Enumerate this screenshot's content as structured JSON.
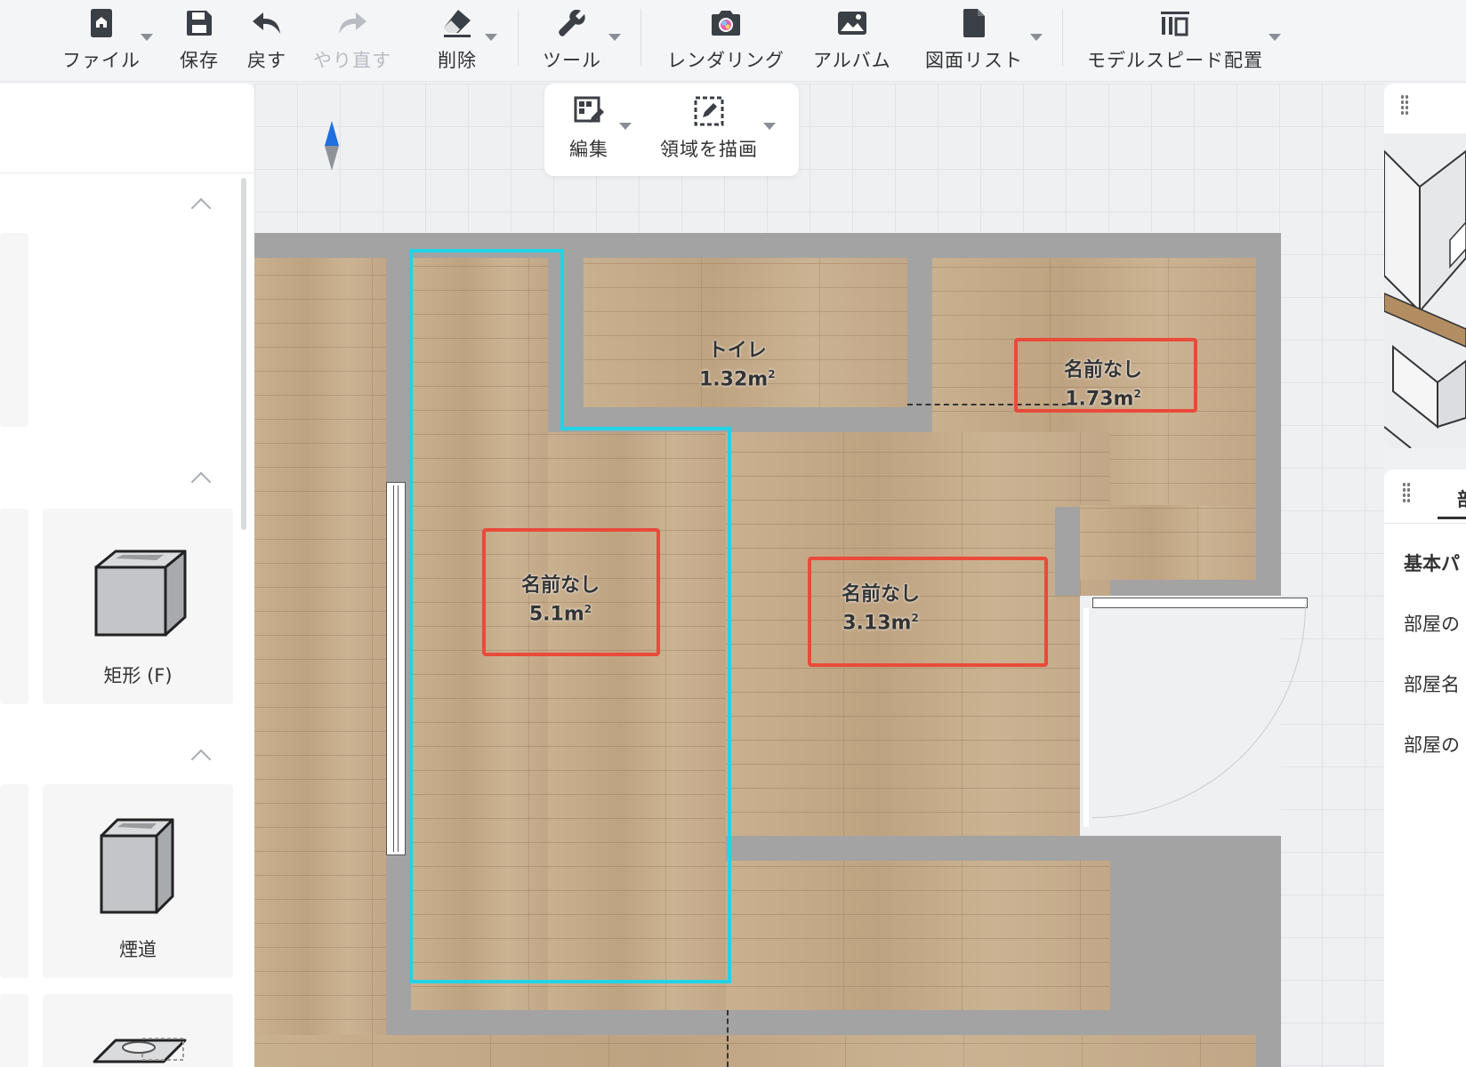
{
  "toolbar": {
    "file": "ファイル",
    "save": "保存",
    "undo": "戻す",
    "redo": "やり直す",
    "delete": "削除",
    "tools": "ツール",
    "rendering": "レンダリング",
    "album": "アルバム",
    "drawing_list": "図面リスト",
    "model_speed_layout": "モデルスピード配置"
  },
  "subtoolbar": {
    "edit": "編集",
    "draw_area": "領域を描画"
  },
  "left_panel": {
    "items": [
      {
        "label": "矩形 (F)",
        "icon": "rectangle-box-icon"
      },
      {
        "label": "煙道",
        "icon": "flue-icon"
      }
    ]
  },
  "rooms": [
    {
      "name": "トイレ",
      "area": "1.32m",
      "unit_sup": "2",
      "highlighted": false
    },
    {
      "name": "名前なし",
      "area": "1.73m",
      "unit_sup": "2",
      "highlighted": true
    },
    {
      "name": "名前なし",
      "area": "5.1m",
      "unit_sup": "2",
      "highlighted": true
    },
    {
      "name": "名前なし",
      "area": "3.13m",
      "unit_sup": "2",
      "highlighted": true
    }
  ],
  "right_panel": {
    "tab_partial": "部",
    "section_title_partial": "基本パ",
    "rows": [
      "部屋の",
      "部屋名",
      "部屋の"
    ]
  },
  "colors": {
    "selection_outline": "#22d3e6",
    "highlight_box": "#ea4a3a",
    "wall": "#a3a3a3",
    "compass_north": "#1f6fe0"
  }
}
